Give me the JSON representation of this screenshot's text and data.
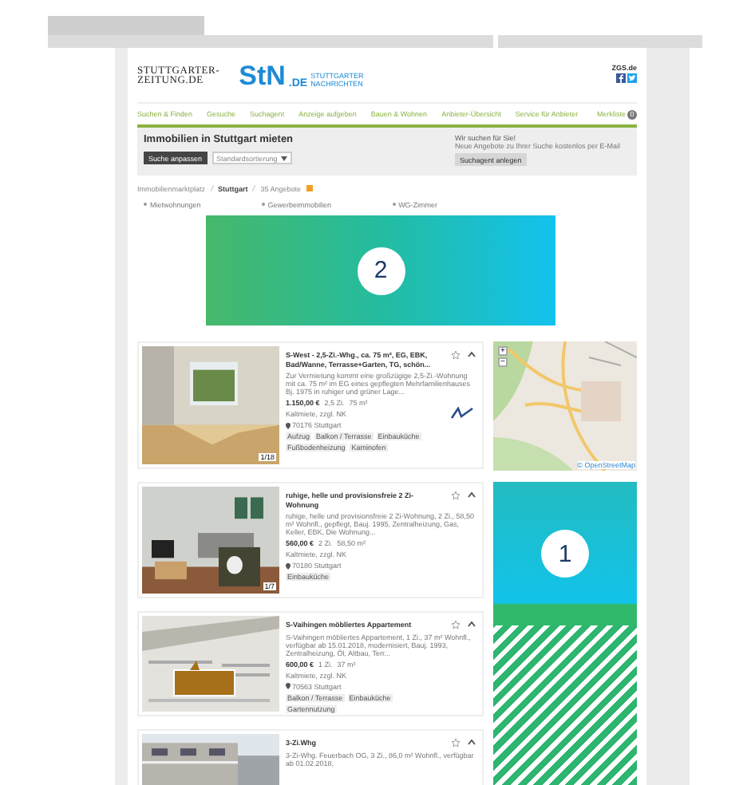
{
  "header": {
    "logo_primary": [
      "STUTTGARTER-",
      "ZEITUNG.DE"
    ],
    "logo_secondary": "StN",
    "logo_secondary_suffix": ".DE",
    "logo_secondary_sub": [
      "STUTTGARTER",
      "NACHRICHTEN"
    ],
    "partner": "ZGS.de"
  },
  "nav": {
    "items": [
      {
        "label": "Suchen & Finden",
        "selected": false
      },
      {
        "label": "Gesuche",
        "selected": false
      },
      {
        "label": "Suchagent",
        "selected": false
      },
      {
        "label": "Anzeige aufgeben",
        "selected": false
      },
      {
        "label": "Bauen & Wohnen",
        "selected": false
      },
      {
        "label": "Anbieter-Übersicht",
        "selected": false
      },
      {
        "label": "Service für Anbieter",
        "selected": false
      }
    ],
    "watchlist": "Merkliste",
    "watchlist_count": "0"
  },
  "search": {
    "title": "Immobilien in Stuttgart mieten",
    "adjust_button": "Suche anpassen",
    "sort": "Standardsortierung",
    "agent_title": "Wir suchen für Sie!",
    "agent_text": "Neue Angebote zu Ihrer Suche kostenlos per E-Mail",
    "agent_button": "Suchagent anlegen"
  },
  "breadcrumb": [
    "Immobilienmarktplatz",
    "Stuttgart",
    "35 Angebote"
  ],
  "categories": [
    "Mietwohnungen",
    "Gewerbeimmobilien",
    "WG-Zimmer"
  ],
  "ad_slots": [
    {
      "number": "2"
    },
    {
      "number": "1"
    }
  ],
  "listings": [
    {
      "photo_count": "1/18",
      "title": "S-West - 2,5-Zi.-Whg., ca. 75 m², EG, EBK, Bad/Wanne, Terrasse+Garten, TG, schön...",
      "description": "Zur Vermietung kommt eine großzügige 2,5-Zi.-Wohnung mit ca. 75 m² im EG eines gepflegten Mehrfamilienhauses Bj. 1975 in ruhiger und grüner Lage...",
      "price": "1.150,00 €",
      "rooms": "2,5 Zi.",
      "area": "75 m²",
      "price_note": "Kaltmiete, zzgl. NK",
      "location": "70176 Stuttgart",
      "tags": [
        "Aufzug",
        "Balkon / Terrasse",
        "Einbauküche",
        "Fußbodenheizung",
        "Kaminofen"
      ],
      "agent_logo": true
    },
    {
      "photo_count": "1/7",
      "title": "ruhige, helle und provisionsfreie 2 Zi-Wohnung",
      "description": "ruhige, helle und provisionsfreie 2 Zi-Wohnung, 2 Zi., 58,50 m² Wohnfl., gepflegt, Bauj. 1995, Zentralheizung, Gas, Keller, EBK, Die Wohnung...",
      "price": "560,00 €",
      "rooms": "2 Zi.",
      "area": "58,50 m²",
      "price_note": "Kaltmiete, zzgl. NK",
      "location": "70180 Stuttgart",
      "tags": [
        "Einbauküche"
      ],
      "agent_logo": false
    },
    {
      "title": "S-Vaihingen möbliertes Appartement",
      "description": "S-Vaihingen möbliertes Appartement, 1 Zi., 37 m² Wohnfl., verfügbar ab 15.01.2018, modernisiert, Bauj. 1993, Zentralheizung, Öl, Altbau, Terr...",
      "price": "600,00 €",
      "rooms": "1 Zi.",
      "area": "37 m²",
      "price_note": "Kaltmiete, zzgl. NK",
      "location": "70563 Stuttgart",
      "tags": [
        "Balkon / Terrasse",
        "Einbauküche",
        "Gartennutzung"
      ],
      "agent_logo": false
    },
    {
      "title": "3-Zi.Whg",
      "description": "3-Zi-Whg. Feuerbach OG, 3 Zi., 86,0 m² Wohnfl., verfügbar ab 01.02.2018,",
      "agent_logo": false
    }
  ],
  "map": {
    "zoom_in": "+",
    "zoom_out": "−",
    "attribution": "© OpenStreetMap"
  }
}
